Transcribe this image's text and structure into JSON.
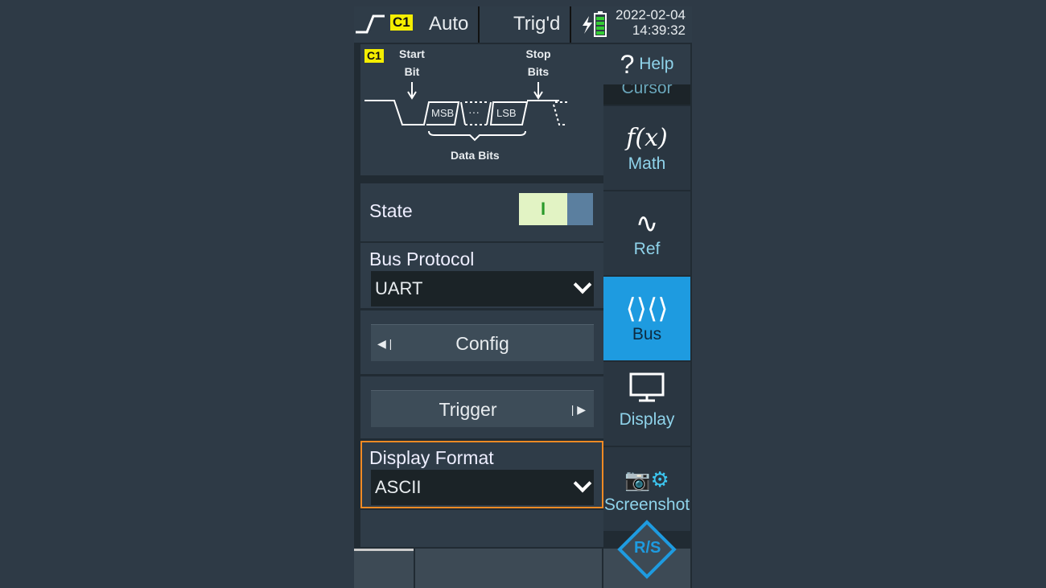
{
  "topbar": {
    "trigger_source": "C1",
    "mode": "Auto",
    "status": "Trig'd",
    "date": "2022-02-04",
    "time": "14:39:32"
  },
  "diagram": {
    "channel": "C1",
    "start_bit": [
      "Start",
      "Bit"
    ],
    "stop_bits": [
      "Stop",
      "Bits"
    ],
    "msb": "MSB",
    "dots": "···",
    "lsb": "LSB",
    "data_bits": "Data Bits"
  },
  "state": {
    "label": "State",
    "toggle_value": "I",
    "on": true
  },
  "bus_protocol": {
    "label": "Bus Protocol",
    "value": "UART"
  },
  "config": {
    "label": "Config"
  },
  "trigger": {
    "label": "Trigger"
  },
  "display_format": {
    "label": "Display Format",
    "value": "ASCII"
  },
  "sidebar": {
    "help": "Help",
    "cursor": "Cursor",
    "math": "Math",
    "ref": "Ref",
    "bus": "Bus",
    "display": "Display",
    "screenshot": "Screenshot"
  },
  "logo": "R/S",
  "colors": {
    "accent": "#1e9be0",
    "focus": "#f08a24",
    "channel": "#f4ee00",
    "label": "#8fd3ea"
  }
}
